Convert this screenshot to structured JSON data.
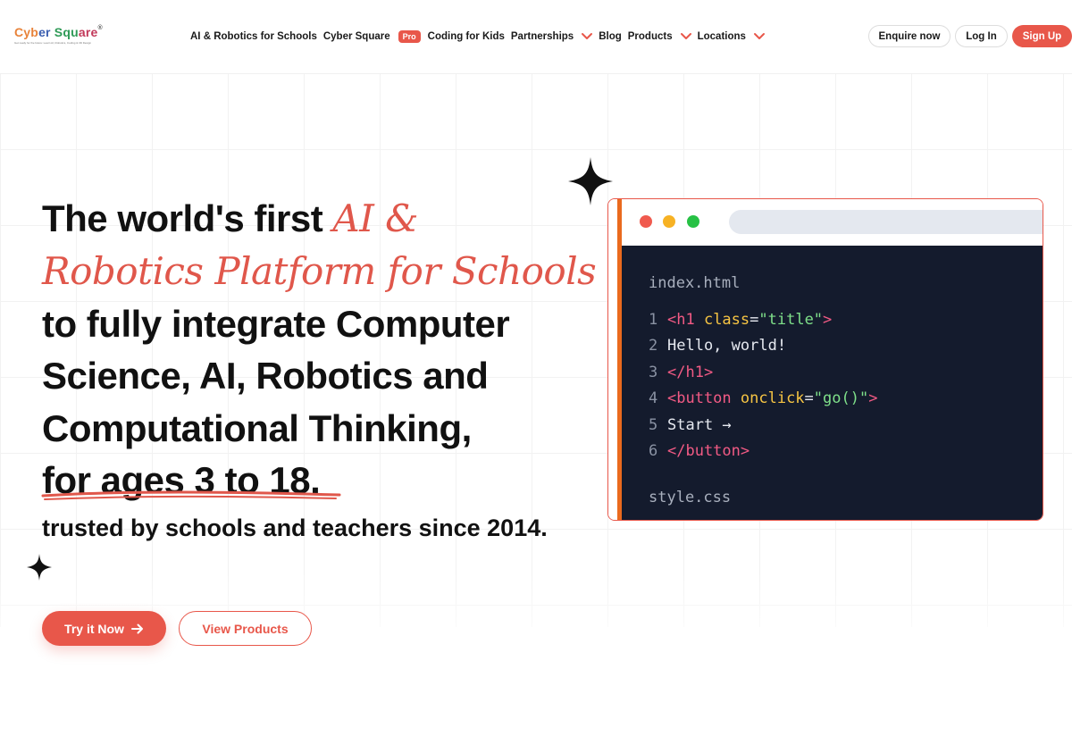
{
  "header": {
    "logo": {
      "parts": [
        "Cyb",
        "er",
        " Squ",
        "are"
      ],
      "registered": "®",
      "tagline": "Get ready for the future: Learn AI, Robotics, Coding & 3D Design"
    },
    "nav": [
      {
        "label": "AI & Robotics for Schools"
      },
      {
        "label": "Cyber Square"
      },
      {
        "badge": "Pro"
      },
      {
        "label": "Coding for Kids"
      },
      {
        "label": "Partnerships",
        "dropdown": true
      },
      {
        "label": "Blog"
      },
      {
        "label": "Products",
        "dropdown": true
      },
      {
        "label": "Locations",
        "dropdown": true
      }
    ],
    "enquire_label": "Enquire now",
    "login_label": "Log In",
    "signup_label": "Sign Up"
  },
  "hero": {
    "line1_plain": "The world's first ",
    "line1_script": "AI &",
    "line2_script": "Robotics Platform for Schools",
    "line3": "to fully integrate Computer",
    "line4": "Science, AI, Robotics and",
    "line5": "Computational Thinking,",
    "line6": "for ages 3 to 18.",
    "trusted": "trusted by schools and teachers since 2014.",
    "cta_primary": "Try it Now",
    "cta_secondary": "View Products"
  },
  "code_window": {
    "file1": "index.html",
    "lines": [
      {
        "num": "1",
        "tokens": [
          {
            "t": "tag",
            "v": "<h1 "
          },
          {
            "t": "attr",
            "v": "class"
          },
          {
            "t": "plain",
            "v": "="
          },
          {
            "t": "str",
            "v": "\"title\""
          },
          {
            "t": "tag",
            "v": ">"
          }
        ]
      },
      {
        "num": "2",
        "tokens": [
          {
            "t": "plain",
            "v": "Hello, world!"
          }
        ]
      },
      {
        "num": "3",
        "tokens": [
          {
            "t": "tag",
            "v": "</h1>"
          }
        ]
      },
      {
        "num": "4",
        "tokens": [
          {
            "t": "tag",
            "v": "<button "
          },
          {
            "t": "attr",
            "v": "onclick"
          },
          {
            "t": "plain",
            "v": "="
          },
          {
            "t": "str",
            "v": "\"go()\""
          },
          {
            "t": "tag",
            "v": ">"
          }
        ]
      },
      {
        "num": "5",
        "tokens": [
          {
            "t": "plain",
            "v": "Start →"
          }
        ]
      },
      {
        "num": "6",
        "tokens": [
          {
            "t": "tag",
            "v": "</button>"
          }
        ]
      }
    ],
    "file2": "style.css"
  },
  "colors": {
    "accent": "#e8574a",
    "code_bg": "#141b2d",
    "window_accent": "#ea6a1e"
  },
  "icons": {
    "cta_arrow": "arrow-right-icon",
    "decor": "sparkle-icon",
    "dropdown": "chevron-down-icon"
  }
}
